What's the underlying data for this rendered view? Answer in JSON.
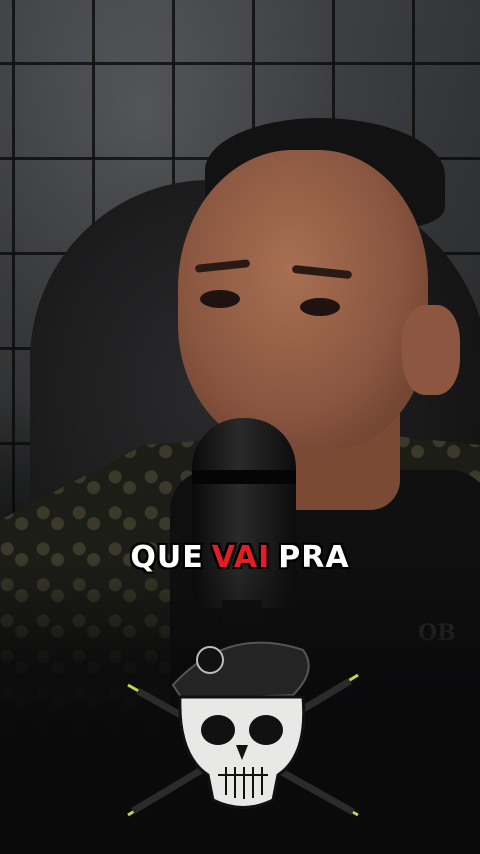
{
  "video": {
    "caption_words": [
      {
        "text": "QUE",
        "color": "#ffffff"
      },
      {
        "text": "VAI",
        "color": "#e21d28"
      },
      {
        "text": "PRA",
        "color": "#ffffff"
      }
    ]
  },
  "overlay": {
    "logo_icon": "skull-beret-crossed-rifles-icon",
    "logo_accent": "#c9d24a"
  },
  "background": {
    "brand_mark": "OB"
  }
}
